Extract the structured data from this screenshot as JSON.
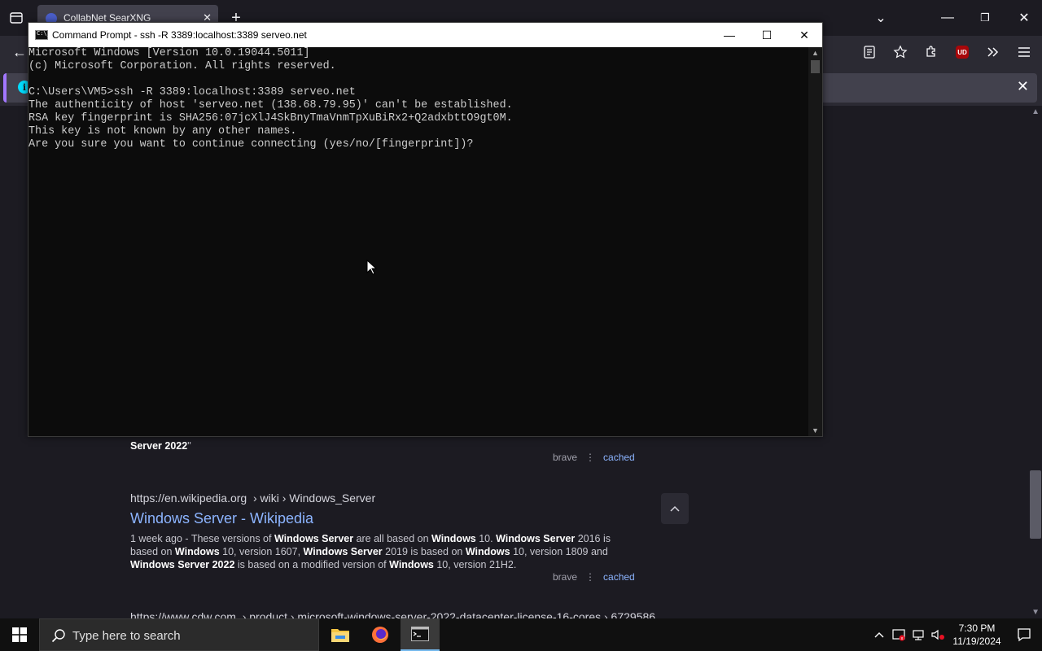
{
  "browser": {
    "tab": {
      "title": "CollabNet SearXNG"
    },
    "new_tab_glyph": "+",
    "tab_close_glyph": "✕",
    "back_glyph": "←",
    "min_glyph": "—",
    "max_glyph": "❐",
    "close_glyph": "✕",
    "overflow_glyph": "⌄",
    "infobar_close_glyph": "✕",
    "info_glyph": "i",
    "ublock_label": "UD",
    "nav_icons": [
      "reader-view-icon",
      "bookmark-star-icon",
      "extensions-icon",
      "ublock-origin-icon",
      "more-tools-icon",
      "app-menu-icon"
    ]
  },
  "page": {
    "result1": {
      "snippet_bold": "Server 2022",
      "snippet_suffix": "\"",
      "source": "brave",
      "dots": "⋮",
      "cached": "cached"
    },
    "result2": {
      "url_host": "https://en.wikipedia.org",
      "url_path": "› wiki › Windows_Server",
      "title": "Windows Server - Wikipedia",
      "source": "brave",
      "dots": "⋮",
      "cached": "cached"
    },
    "result3": {
      "url_host": "https://www.cdw.com",
      "url_path": "› product › microsoft-windows-server-2022-datacenter-license-16-cores › 6729586"
    },
    "scroll_top_glyph": "^"
  },
  "cmd": {
    "title": "Command Prompt - ssh  -R 3389:localhost:3389 serveo.net",
    "lines": [
      "Microsoft Windows [Version 10.0.19044.5011]",
      "(c) Microsoft Corporation. All rights reserved.",
      "",
      "C:\\Users\\VM5>ssh -R 3389:localhost:3389 serveo.net",
      "The authenticity of host 'serveo.net (138.68.79.95)' can't be established.",
      "RSA key fingerprint is SHA256:07jcXlJ4SkBnyTmaVnmTpXuBiRx2+Q2adxbttO9gt0M.",
      "This key is not known by any other names.",
      "Are you sure you want to continue connecting (yes/no/[fingerprint])?"
    ],
    "min_glyph": "—",
    "max_glyph": "☐",
    "close_glyph": "✕"
  },
  "taskbar": {
    "search_placeholder": "Type here to search",
    "time": "7:30 PM",
    "date": "11/19/2024",
    "tray_up_glyph": "^"
  }
}
